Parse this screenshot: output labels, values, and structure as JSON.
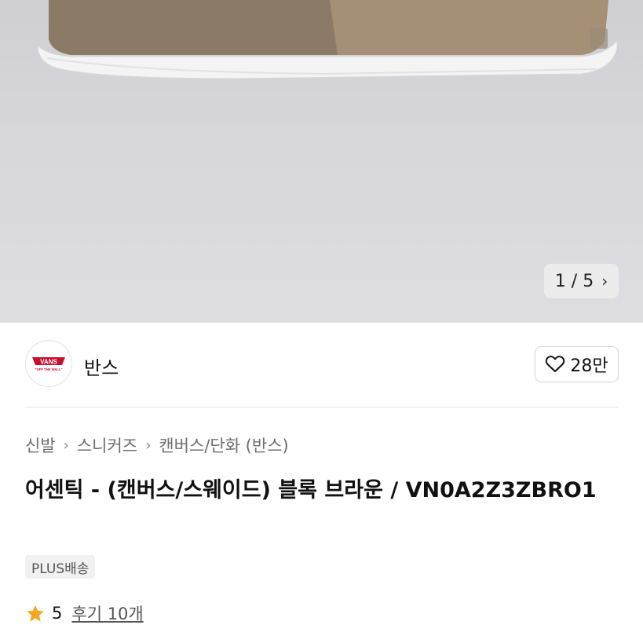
{
  "gallery": {
    "current": "1",
    "separator": "/",
    "total": "5"
  },
  "brand": {
    "name": "반스",
    "logo_text": "VANS",
    "logo_subtext": "\"OFF THE WALL\"",
    "likes": "28만"
  },
  "breadcrumb": [
    "신발",
    "스니커즈",
    "캔버스/단화 (반스)"
  ],
  "product": {
    "title": "어센틱 - (캔버스/스웨이드) 블록 브라운 / VN0A2Z3ZBRO1",
    "shipping_tag": "PLUS배송",
    "rating": "5",
    "reviews": "후기 10개"
  },
  "colors": {
    "star": "#f5a623",
    "heart": "#111111",
    "hero_bg": "#d8d8dc"
  }
}
